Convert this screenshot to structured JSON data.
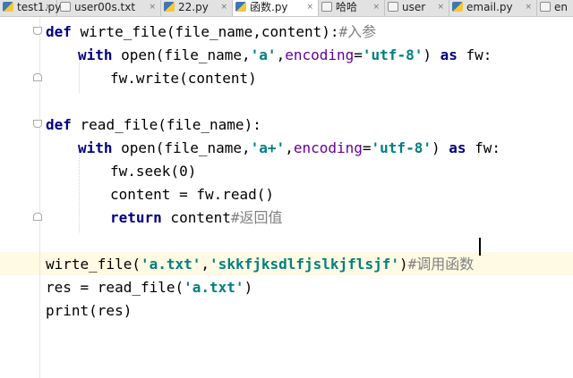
{
  "tabs": [
    {
      "label": "test1.py",
      "icon": "python-file-icon",
      "active": false
    },
    {
      "label": "user00s.txt",
      "icon": "text-file-icon",
      "active": false
    },
    {
      "label": "22.py",
      "icon": "python-file-icon",
      "active": false
    },
    {
      "label": "函数.py",
      "icon": "python-file-icon",
      "active": true
    },
    {
      "label": "哈哈",
      "icon": "text-file-icon",
      "active": false
    },
    {
      "label": "user",
      "icon": "text-file-icon",
      "active": false
    },
    {
      "label": "email.py",
      "icon": "python-file-icon",
      "active": false
    },
    {
      "label": "en",
      "icon": "text-file-icon",
      "active": false
    }
  ],
  "close_glyph": "×",
  "code": {
    "l1": {
      "kw": "def",
      "rest": " wirte_file(file_name,content):",
      "comment": "#入参"
    },
    "l2": {
      "kw": "with",
      "a": " open(file_name,",
      "s1": "'a'",
      "b": ",",
      "p": "encoding",
      "c": "=",
      "s2": "'utf-8'",
      "d": ") ",
      "kw2": "as",
      "e": " fw:"
    },
    "l3": {
      "text": "fw.write(content)"
    },
    "l5": {
      "kw": "def",
      "rest": " read_file(file_name):"
    },
    "l6": {
      "kw": "with",
      "a": " open(file_name,",
      "s1": "'a+'",
      "b": ",",
      "p": "encoding",
      "c": "=",
      "s2": "'utf-8'",
      "d": ") ",
      "kw2": "as",
      "e": " fw:"
    },
    "l7": {
      "text": "fw.seek(0)"
    },
    "l8": {
      "text": "content = fw.read()"
    },
    "l9": {
      "kw": "return",
      "rest": " content",
      "comment": "#返回值"
    },
    "l11": {
      "a": "wirte_file(",
      "s1": "'a.txt'",
      "b": ",",
      "s2": "'skkfjksdlfjslkjflsjf'",
      "c": ")",
      "comment": "#调用函数"
    },
    "l12": {
      "a": "res = read_file(",
      "s1": "'a.txt'",
      "b": ")"
    },
    "l13": {
      "text": "print(res)"
    }
  }
}
